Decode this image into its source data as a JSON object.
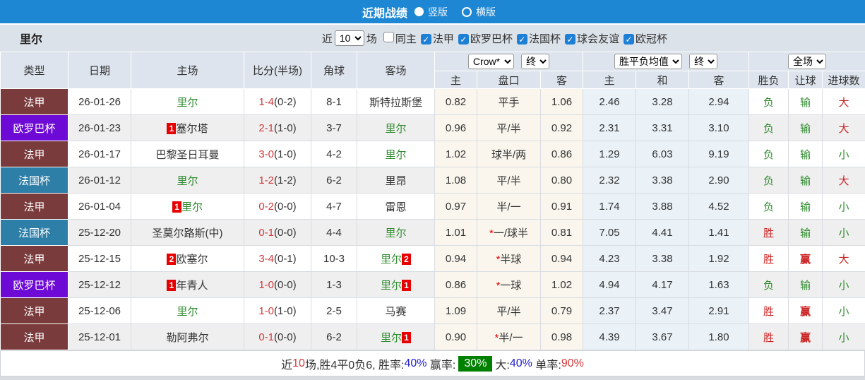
{
  "titlebar": {
    "title": "近期战绩",
    "radio_vertical": "竖版",
    "radio_horizontal": "横版"
  },
  "toolbar": {
    "team": "里尔",
    "recent_label": "近",
    "recent_value": "10",
    "games_label": "场",
    "filters": [
      {
        "label": "同主",
        "checked": false
      },
      {
        "label": "法甲",
        "checked": true
      },
      {
        "label": "欧罗巴杯",
        "checked": true
      },
      {
        "label": "法国杯",
        "checked": true
      },
      {
        "label": "球会友谊",
        "checked": true
      },
      {
        "label": "欧冠杯",
        "checked": true
      }
    ]
  },
  "header": {
    "static": [
      "类型",
      "日期",
      "主场",
      "比分(半场)",
      "角球",
      "客场"
    ],
    "odds_company_select": "Crow*",
    "odds_time_select": "终",
    "euro_select": "胜平负均值",
    "euro_time_select": "终",
    "scope_select": "全场",
    "sub": [
      "主",
      "盘口",
      "客",
      "主",
      "和",
      "客",
      "胜负",
      "让球",
      "进球数"
    ]
  },
  "league_colors": {
    "法甲": "#7a3b3d",
    "欧罗巴杯": "#6e0ad6",
    "法国杯": "#2e7fa8"
  },
  "result_colors": {
    "胜": "#cc2222",
    "负": "#2f8b2f",
    "赢": "#cc2222",
    "输": "#2f8b2f",
    "大": "#cc2222",
    "小": "#2f8b2f"
  },
  "rows": [
    {
      "league": "法甲",
      "date": "26-01-26",
      "home": {
        "name": "里尔",
        "green": true
      },
      "ft": "1-4",
      "ht": "(0-2)",
      "corner": "8-1",
      "away": {
        "name": "斯特拉斯堡",
        "green": false
      },
      "odds": [
        "0.82",
        "平手",
        "1.06"
      ],
      "euro": [
        "2.46",
        "3.28",
        "2.94"
      ],
      "results": [
        "负",
        "输",
        "大"
      ]
    },
    {
      "league": "欧罗巴杯",
      "date": "26-01-23",
      "home": {
        "name": "塞尔塔",
        "green": false,
        "badge": "1"
      },
      "ft": "2-1",
      "ht": "(1-0)",
      "corner": "3-7",
      "away": {
        "name": "里尔",
        "green": true
      },
      "odds": [
        "0.96",
        "平/半",
        "0.92"
      ],
      "euro": [
        "2.31",
        "3.31",
        "3.10"
      ],
      "results": [
        "负",
        "输",
        "大"
      ]
    },
    {
      "league": "法甲",
      "date": "26-01-17",
      "home": {
        "name": "巴黎圣日耳曼",
        "green": false
      },
      "ft": "3-0",
      "ht": "(1-0)",
      "corner": "4-2",
      "away": {
        "name": "里尔",
        "green": true
      },
      "odds": [
        "1.02",
        "球半/两",
        "0.86"
      ],
      "euro": [
        "1.29",
        "6.03",
        "9.19"
      ],
      "results": [
        "负",
        "输",
        "小"
      ]
    },
    {
      "league": "法国杯",
      "date": "26-01-12",
      "home": {
        "name": "里尔",
        "green": true
      },
      "ft": "1-2",
      "ht": "(1-2)",
      "corner": "6-2",
      "away": {
        "name": "里昂",
        "green": false
      },
      "odds": [
        "1.08",
        "平/半",
        "0.80"
      ],
      "euro": [
        "2.32",
        "3.38",
        "2.90"
      ],
      "results": [
        "负",
        "输",
        "大"
      ]
    },
    {
      "league": "法甲",
      "date": "26-01-04",
      "home": {
        "name": "里尔",
        "green": true,
        "badge": "1"
      },
      "ft": "0-2",
      "ht": "(0-0)",
      "corner": "4-7",
      "away": {
        "name": "雷恩",
        "green": false
      },
      "odds": [
        "0.97",
        "半/一",
        "0.91"
      ],
      "euro": [
        "1.74",
        "3.88",
        "4.52"
      ],
      "results": [
        "负",
        "输",
        "小"
      ]
    },
    {
      "league": "法国杯",
      "date": "25-12-20",
      "home": {
        "name": "圣莫尔路斯(中)",
        "green": false
      },
      "ft": "0-1",
      "ht": "(0-0)",
      "corner": "4-4",
      "away": {
        "name": "里尔",
        "green": true
      },
      "odds": [
        "1.01",
        "*一/球半",
        "0.81"
      ],
      "euro": [
        "7.05",
        "4.41",
        "1.41"
      ],
      "results": [
        "胜",
        "输",
        "小"
      ]
    },
    {
      "league": "法甲",
      "date": "25-12-15",
      "home": {
        "name": "欧塞尔",
        "green": false,
        "badge": "2"
      },
      "ft": "3-4",
      "ht": "(0-1)",
      "corner": "10-3",
      "away": {
        "name": "里尔",
        "green": true,
        "badge": "2"
      },
      "odds": [
        "0.94",
        "*半球",
        "0.94"
      ],
      "euro": [
        "4.23",
        "3.38",
        "1.92"
      ],
      "results": [
        "胜",
        "赢",
        "大"
      ]
    },
    {
      "league": "欧罗巴杯",
      "date": "25-12-12",
      "home": {
        "name": "年青人",
        "green": false,
        "badge": "1"
      },
      "ft": "1-0",
      "ht": "(0-0)",
      "corner": "1-3",
      "away": {
        "name": "里尔",
        "green": true,
        "badge": "1"
      },
      "odds": [
        "0.86",
        "*一球",
        "1.02"
      ],
      "euro": [
        "4.94",
        "4.17",
        "1.63"
      ],
      "results": [
        "负",
        "输",
        "小"
      ]
    },
    {
      "league": "法甲",
      "date": "25-12-06",
      "home": {
        "name": "里尔",
        "green": true
      },
      "ft": "1-0",
      "ht": "(1-0)",
      "corner": "2-5",
      "away": {
        "name": "马赛",
        "green": false
      },
      "odds": [
        "1.09",
        "平/半",
        "0.79"
      ],
      "euro": [
        "2.37",
        "3.47",
        "2.91"
      ],
      "results": [
        "胜",
        "赢",
        "小"
      ]
    },
    {
      "league": "法甲",
      "date": "25-12-01",
      "home": {
        "name": "勒阿弗尔",
        "green": false
      },
      "ft": "0-1",
      "ht": "(0-0)",
      "corner": "6-2",
      "away": {
        "name": "里尔",
        "green": true,
        "badge": "1"
      },
      "odds": [
        "0.90",
        "*半/一",
        "0.98"
      ],
      "euro": [
        "4.39",
        "3.67",
        "1.80"
      ],
      "results": [
        "胜",
        "赢",
        "小"
      ]
    }
  ],
  "footer": {
    "segments": [
      {
        "text": "近",
        "color": "#333333"
      },
      {
        "text": "10",
        "color": "#d33a3a"
      },
      {
        "text": "场,胜4平0负6, ",
        "color": "#333333"
      },
      {
        "text": "胜率:",
        "color": "#333333"
      },
      {
        "text": "40%",
        "color": "#2222cc"
      },
      {
        "text": " 赢率:",
        "color": "#333333"
      },
      {
        "text": "30%",
        "color": "#ffffff",
        "bg": "#008000"
      },
      {
        "text": "大:",
        "color": "#333333"
      },
      {
        "text": "40%",
        "color": "#2222cc"
      },
      {
        "text": " 单率:",
        "color": "#333333"
      },
      {
        "text": "90%",
        "color": "#d33a3a"
      }
    ]
  }
}
